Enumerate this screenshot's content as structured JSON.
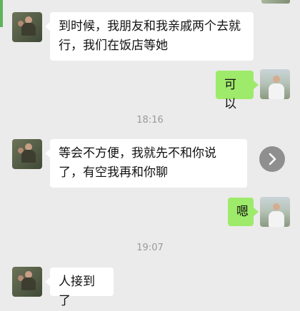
{
  "colors": {
    "background": "#ebebeb",
    "incoming_bubble": "#ffffff",
    "outgoing_bubble": "#9eea6a",
    "timestamp_text": "#9a9a9a"
  },
  "messages": [
    {
      "direction": "in",
      "text": "到时候，我朋友和我亲戚两个去就行，我们在饭店等她"
    },
    {
      "direction": "out",
      "text": "可以"
    },
    {
      "direction": "in",
      "text": "等会不方便，我就先不和你说了，有空我再和你聊"
    },
    {
      "direction": "out",
      "text": "嗯"
    },
    {
      "direction": "in",
      "text": "人接到了"
    }
  ],
  "timestamps": [
    "18:16",
    "19:07"
  ],
  "icons": {
    "next": "chevron-right-icon"
  }
}
